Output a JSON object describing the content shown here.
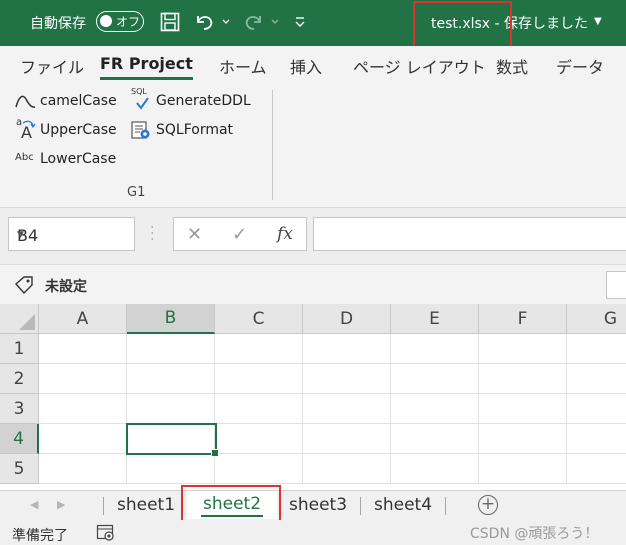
{
  "titlebar": {
    "autosave_label": "自動保存",
    "autosave_state": "オフ",
    "filename": "test.xlsx - 保存しました",
    "accent_color": "#217346"
  },
  "ribbon": {
    "tabs": [
      {
        "label": "ファイル"
      },
      {
        "label": "FR Project",
        "active": true
      },
      {
        "label": "ホーム"
      },
      {
        "label": "挿入"
      },
      {
        "label": "ページ レイアウト"
      },
      {
        "label": "数式"
      },
      {
        "label": "データ"
      }
    ],
    "buttons": [
      {
        "label": "camelCase",
        "icon": "tilde-curve-icon"
      },
      {
        "label": "GenerateDDL",
        "icon": "sql-check-icon"
      },
      {
        "label": "UpperCase",
        "icon": "uppercase-icon"
      },
      {
        "label": "SQLFormat",
        "icon": "sql-format-icon"
      },
      {
        "label": "LowerCase",
        "icon": "lowercase-icon"
      }
    ],
    "group_label": "G1",
    "uppercase_icon_text": {
      "small": "a",
      "big": "A"
    },
    "sql_icon_text": "SQL",
    "lowercase_icon_text": "Abc"
  },
  "formula_bar": {
    "name_box": "B4",
    "cancel_symbol": "✕",
    "enter_symbol": "✓",
    "fx_symbol": "fx",
    "formula_value": ""
  },
  "sensitivity": {
    "label": "未設定"
  },
  "grid": {
    "columns": [
      "A",
      "B",
      "C",
      "D",
      "E",
      "F",
      "G"
    ],
    "rows": [
      "1",
      "2",
      "3",
      "4",
      "5"
    ],
    "selected_column": "B",
    "selected_row": "4",
    "active_cell": "B4"
  },
  "sheets": {
    "tabs": [
      "sheet1",
      "sheet2",
      "sheet3",
      "sheet4"
    ],
    "active": "sheet2",
    "add_symbol": "+"
  },
  "statusbar": {
    "status": "準備完了",
    "watermark": "CSDN @頑張ろう！"
  }
}
